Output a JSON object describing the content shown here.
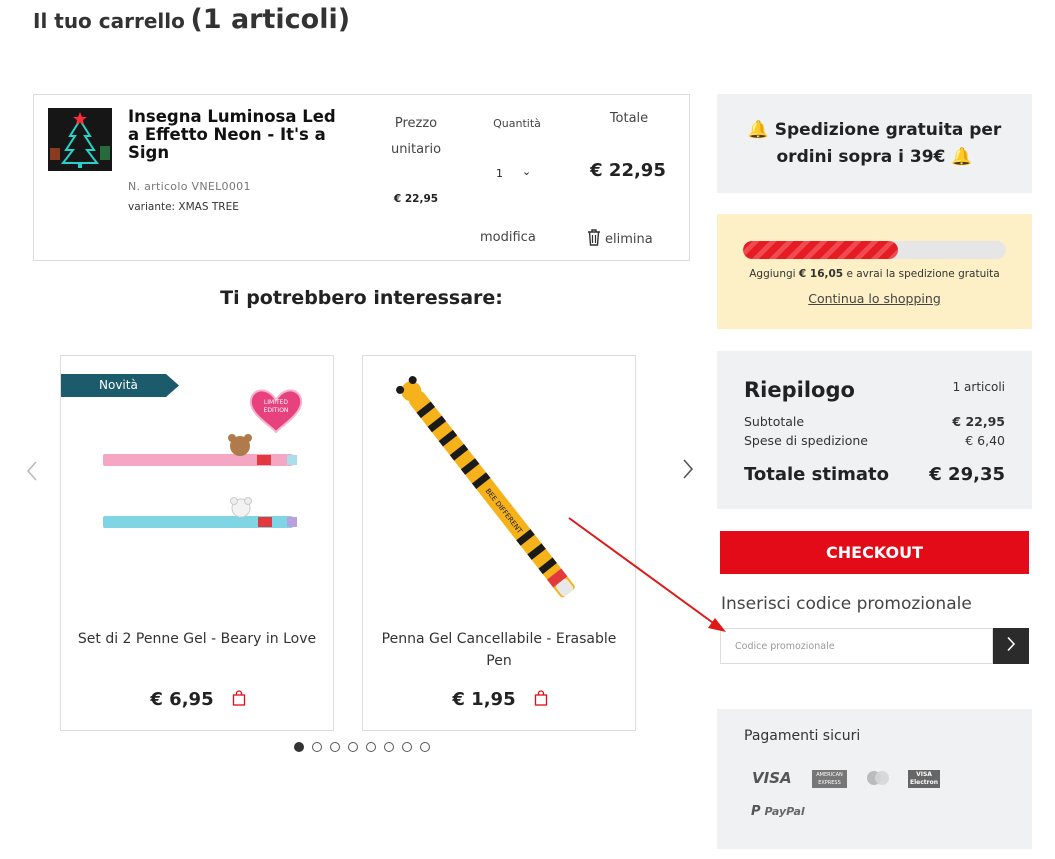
{
  "header": {
    "title_prefix": "Il tuo carrello",
    "title_count": "(1 articoli)"
  },
  "cart_item": {
    "name": "Insegna Luminosa Led a Effetto Neon - It's a Sign",
    "sku": "N. articolo VNEL0001",
    "variant": "variante: XMAS TREE",
    "unit_price_header": "Prezzo unitario",
    "unit_price": "€ 22,95",
    "quantity_header": "Quantità",
    "quantity": "1",
    "total_header": "Totale",
    "total": "€ 22,95",
    "modify_label": "modifica",
    "delete_label": "elimina"
  },
  "recommendations": {
    "title": "Ti potrebbero interessare:",
    "products": [
      {
        "badge": "Novità",
        "badge_image_text": "LIMITED EDITION",
        "name": "Set di 2 Penne Gel - Beary in Love",
        "price": "€ 6,95"
      },
      {
        "name": "Penna Gel Cancellabile - Erasable Pen",
        "pen_text": "BEE DIFFERENT",
        "price": "€ 1,95"
      }
    ],
    "dots_total": 8,
    "active_dot": 0
  },
  "shipping_banner": {
    "text": "Spedizione gratuita per ordini sopra i 39€"
  },
  "progress": {
    "fraction": 0.59,
    "text_prefix": "Aggiungi",
    "amount": "€ 16,05",
    "text_suffix": "e avrai la spedizione gratuita",
    "continue_label": "Continua lo shopping"
  },
  "summary": {
    "title": "Riepilogo",
    "count": "1 articoli",
    "subtotal_label": "Subtotale",
    "subtotal_value": "€ 22,95",
    "shipping_label": "Spese di spedizione",
    "shipping_value": "€ 6,40",
    "total_label": "Totale stimato",
    "total_value": "€ 29,35"
  },
  "checkout": {
    "label": "CHECKOUT"
  },
  "promo": {
    "label": "Inserisci codice promozionale",
    "placeholder": "Codice promozionale",
    "value": ""
  },
  "payments": {
    "title": "Pagamenti sicuri",
    "visa": "VISA",
    "amex_line1": "AMERICAN",
    "amex_line2": "EXPRESS",
    "visa_electron_line1": "VISA",
    "visa_electron_line2": "Electron",
    "paypal": "PayPal"
  },
  "colors": {
    "accent_red": "#e30b17",
    "badge_teal": "#1b5b6c",
    "progress_bg": "#fdf0c6",
    "panel_gray": "#f0f1f2"
  },
  "icons": [
    "trash-icon",
    "chevron-down-icon",
    "chevron-left-icon",
    "chevron-right-icon",
    "shopping-bag-icon",
    "bell-icon",
    "arrow-right-icon"
  ]
}
